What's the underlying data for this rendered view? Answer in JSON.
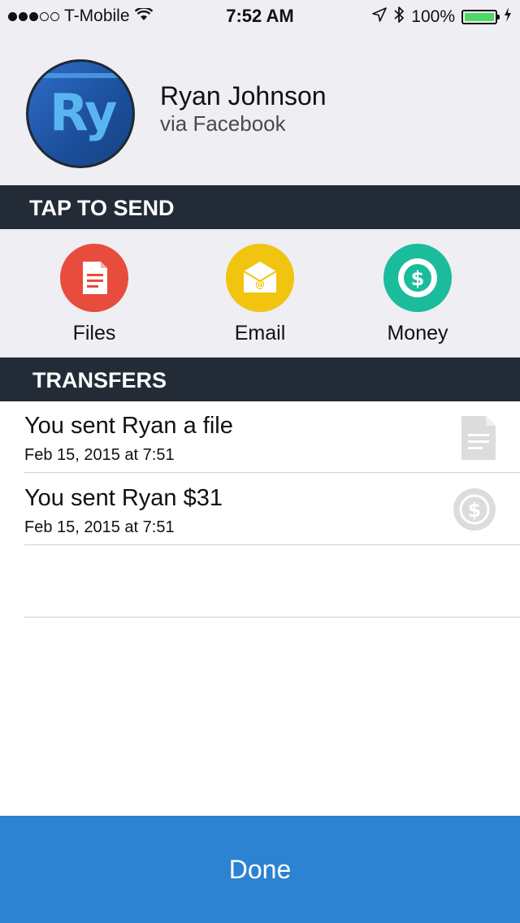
{
  "status_bar": {
    "carrier": "T-Mobile",
    "time": "7:52 AM",
    "battery": "100%",
    "signal_strength": 3,
    "signal_max": 5
  },
  "profile": {
    "name": "Ryan Johnson",
    "source": "via Facebook",
    "avatar_text": "Ry"
  },
  "tap_to_send": {
    "title": "TAP TO SEND",
    "actions": [
      {
        "label": "Files",
        "icon": "document-icon",
        "color": "#e84c3d"
      },
      {
        "label": "Email",
        "icon": "envelope-icon",
        "color": "#f1c40f"
      },
      {
        "label": "Money",
        "icon": "dollar-coin-icon",
        "color": "#1abc9c"
      }
    ]
  },
  "transfers": {
    "title": "TRANSFERS",
    "items": [
      {
        "title": "You sent Ryan a file",
        "date": "Feb 15, 2015 at 7:51",
        "icon": "document-icon"
      },
      {
        "title": "You sent Ryan $31",
        "date": "Feb 15, 2015 at 7:51",
        "icon": "dollar-coin-icon"
      }
    ]
  },
  "done_button": {
    "label": "Done",
    "color": "#2b83d1"
  }
}
